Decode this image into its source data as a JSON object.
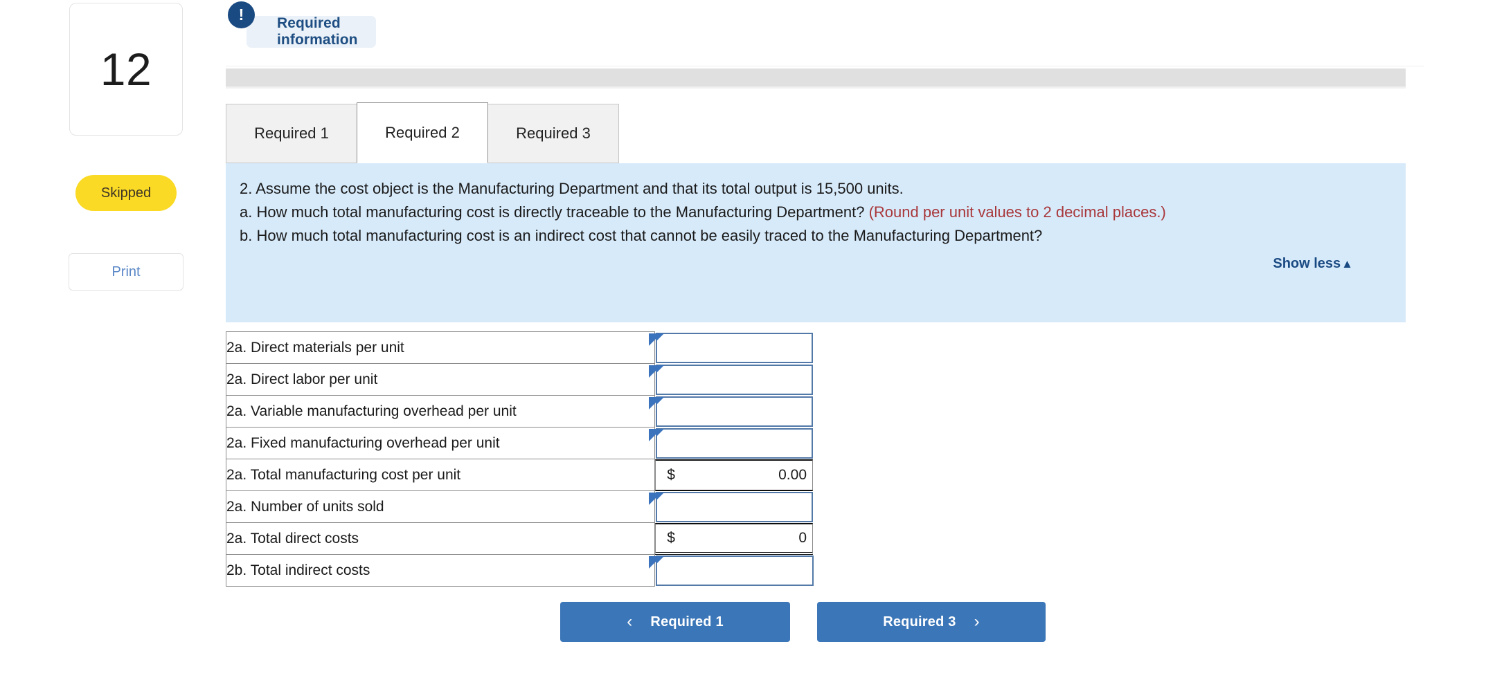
{
  "sidebar": {
    "question_number": "12",
    "status_label": "Skipped",
    "print_label": "Print"
  },
  "header": {
    "required_information_label": "Required information",
    "exclaim_icon": "exclamation-icon",
    "exclaim_glyph": "!"
  },
  "tabs": [
    {
      "label": "Required 1",
      "active": false
    },
    {
      "label": "Required 2",
      "active": true
    },
    {
      "label": "Required 3",
      "active": false
    }
  ],
  "question": {
    "line1": "2. Assume the cost object is the Manufacturing Department and that its total output is 15,500 units.",
    "line2_black": "a. How much total manufacturing cost is directly traceable to the Manufacturing Department? ",
    "line2_red": "(Round per unit values to 2 decimal places.)",
    "line3": "b. How much total manufacturing cost is an indirect cost that cannot be easily traced to the Manufacturing Department?",
    "show_less_label": "Show less",
    "show_less_caret": "▲"
  },
  "answer_table": {
    "rows": [
      {
        "label": "2a. Direct materials per unit",
        "type": "input",
        "value": "",
        "prefix": ""
      },
      {
        "label": "2a. Direct labor per unit",
        "type": "input",
        "value": "",
        "prefix": ""
      },
      {
        "label": "2a. Variable manufacturing overhead per unit",
        "type": "input",
        "value": "",
        "prefix": ""
      },
      {
        "label": "2a. Fixed manufacturing overhead per unit",
        "type": "input",
        "value": "",
        "prefix": ""
      },
      {
        "label": "2a. Total manufacturing cost per unit",
        "type": "total",
        "value": "0.00",
        "prefix": "$"
      },
      {
        "label": "2a. Number of units sold",
        "type": "input",
        "value": "",
        "prefix": ""
      },
      {
        "label": "2a. Total direct costs",
        "type": "total",
        "value": "0",
        "prefix": "$"
      },
      {
        "label": "2b. Total indirect costs",
        "type": "input",
        "value": "",
        "prefix": ""
      }
    ]
  },
  "nav": {
    "prev_label": "Required 1",
    "prev_chevron": "‹",
    "next_label": "Required 3",
    "next_chevron": "›"
  },
  "colors": {
    "accent_blue": "#3b76b8",
    "header_blue": "#1a4a82",
    "question_bg": "#d7eafa",
    "skipped_yellow": "#fada24",
    "warning_red": "#a8373a",
    "input_border": "#5379a8"
  }
}
